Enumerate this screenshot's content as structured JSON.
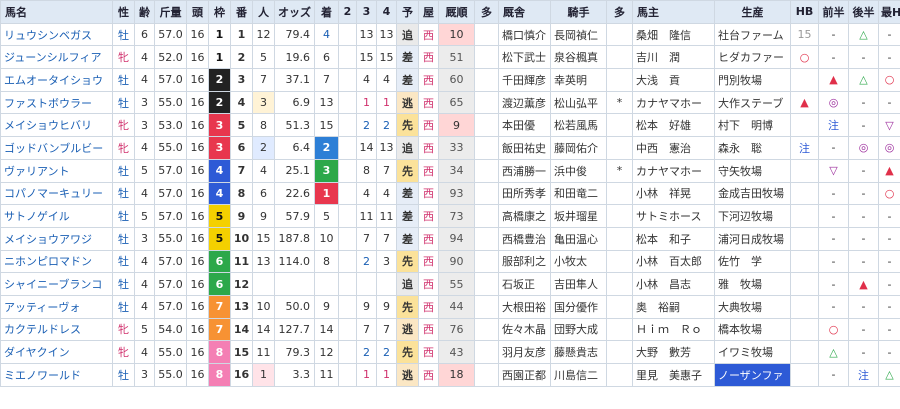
{
  "headers": [
    "馬名",
    "性",
    "齢",
    "斤量",
    "頭",
    "枠",
    "番",
    "人",
    "オッズ",
    "着",
    "2",
    "3",
    "4",
    "予",
    "屋",
    "厩順",
    "多",
    "厩舎",
    "騎手",
    "多",
    "馬主",
    "生産",
    "HB",
    "前半",
    "後半",
    "最H"
  ],
  "rows": [
    {
      "name": "リュウシンベガス",
      "sex": "牡",
      "age": "6",
      "kin": "57.0",
      "tou": "16",
      "waku": "1",
      "ban": "1",
      "pop": "12",
      "odds": "79.4",
      "chaku": "4",
      "c2": "",
      "c3": "13",
      "c4": "13",
      "yoso": "追",
      "ya": "西",
      "kyuu": "10",
      "ta": "",
      "stable": "橋口慎介",
      "jockey": "長岡禎仁",
      "ta2": "",
      "owner": "桑畑　隆信",
      "breeder": "社台ファーム",
      "hb": "15",
      "zen": "-",
      "kou": "△",
      "saih": "-"
    },
    {
      "name": "ジューンシルフィア",
      "sex": "牝",
      "age": "4",
      "kin": "52.0",
      "tou": "16",
      "waku": "1",
      "ban": "2",
      "pop": "5",
      "odds": "19.6",
      "chaku": "6",
      "c2": "",
      "c3": "15",
      "c4": "15",
      "yoso": "差",
      "ya": "西",
      "kyuu": "51",
      "ta": "",
      "stable": "松下武士",
      "jockey": "泉谷楓真",
      "ta2": "",
      "owner": "吉川　潤",
      "breeder": "ヒダカファー",
      "hb": "○",
      "zen": "-",
      "kou": "-",
      "saih": "-"
    },
    {
      "name": "エムオータイショウ",
      "sex": "牡",
      "age": "4",
      "kin": "57.0",
      "tou": "16",
      "waku": "2",
      "ban": "3",
      "pop": "7",
      "odds": "37.1",
      "chaku": "7",
      "c2": "",
      "c3": "4",
      "c4": "4",
      "yoso": "差",
      "ya": "西",
      "kyuu": "60",
      "ta": "",
      "stable": "千田輝彦",
      "jockey": "幸英明",
      "ta2": "",
      "owner": "大浅　貢",
      "breeder": "門別牧場",
      "hb": "",
      "zen": "▲",
      "kou": "△",
      "saih": "○"
    },
    {
      "name": "ファストボウラー",
      "sex": "牡",
      "age": "3",
      "kin": "55.0",
      "tou": "16",
      "waku": "2",
      "ban": "4",
      "pop": "3",
      "odds": "6.9",
      "chaku": "13",
      "c2": "",
      "c3": "1",
      "c4": "1",
      "yoso": "逃",
      "ya": "西",
      "kyuu": "65",
      "ta": "",
      "stable": "渡辺薫彦",
      "jockey": "松山弘平",
      "ta2": "*",
      "owner": "カナヤマホー",
      "breeder": "大作ステーブ",
      "hb": "▲",
      "zen": "◎",
      "kou": "-",
      "saih": "-"
    },
    {
      "name": "メイショウヒバリ",
      "sex": "牝",
      "age": "3",
      "kin": "53.0",
      "tou": "16",
      "waku": "3",
      "ban": "5",
      "pop": "8",
      "odds": "51.3",
      "chaku": "15",
      "c2": "",
      "c3": "2",
      "c4": "2",
      "yoso": "先",
      "ya": "西",
      "kyuu": "9",
      "ta": "",
      "stable": "本田優",
      "jockey": "松若風馬",
      "ta2": "",
      "owner": "松本　好雄",
      "breeder": "村下　明博",
      "hb": "",
      "zen": "注",
      "kou": "-",
      "saih": "▽"
    },
    {
      "name": "ゴッドバンブルビー",
      "sex": "牝",
      "age": "4",
      "kin": "55.0",
      "tou": "16",
      "waku": "3",
      "ban": "6",
      "pop": "2",
      "odds": "6.4",
      "chaku": "2",
      "c2": "",
      "c3": "14",
      "c4": "13",
      "yoso": "追",
      "ya": "西",
      "kyuu": "33",
      "ta": "",
      "stable": "飯田祐史",
      "jockey": "藤岡佑介",
      "ta2": "",
      "owner": "中西　憲治",
      "breeder": "森永　聡",
      "hb": "注",
      "zen": "-",
      "kou": "◎",
      "saih": "◎"
    },
    {
      "name": "ヴァリアント",
      "sex": "牡",
      "age": "5",
      "kin": "57.0",
      "tou": "16",
      "waku": "4",
      "ban": "7",
      "pop": "4",
      "odds": "25.1",
      "chaku": "3",
      "c2": "",
      "c3": "8",
      "c4": "7",
      "yoso": "先",
      "ya": "西",
      "kyuu": "34",
      "ta": "",
      "stable": "西浦勝一",
      "jockey": "浜中俊",
      "ta2": "*",
      "owner": "カナヤマホー",
      "breeder": "守矢牧場",
      "hb": "",
      "zen": "▽",
      "kou": "-",
      "saih": "▲"
    },
    {
      "name": "コパノマーキュリー",
      "sex": "牡",
      "age": "4",
      "kin": "57.0",
      "tou": "16",
      "waku": "4",
      "ban": "8",
      "pop": "6",
      "odds": "22.6",
      "chaku": "1",
      "c2": "",
      "c3": "4",
      "c4": "4",
      "yoso": "差",
      "ya": "西",
      "kyuu": "93",
      "ta": "",
      "stable": "田所秀孝",
      "jockey": "和田竜二",
      "ta2": "",
      "owner": "小林　祥晃",
      "breeder": "金成吉田牧場",
      "hb": "",
      "zen": "-",
      "kou": "-",
      "saih": "○"
    },
    {
      "name": "サトノゲイル",
      "sex": "牡",
      "age": "5",
      "kin": "57.0",
      "tou": "16",
      "waku": "5",
      "ban": "9",
      "pop": "9",
      "odds": "57.9",
      "chaku": "5",
      "c2": "",
      "c3": "11",
      "c4": "11",
      "yoso": "差",
      "ya": "西",
      "kyuu": "73",
      "ta": "",
      "stable": "高橋康之",
      "jockey": "坂井瑠星",
      "ta2": "",
      "owner": "サトミホース",
      "breeder": "下河辺牧場",
      "hb": "",
      "zen": "-",
      "kou": "-",
      "saih": "-"
    },
    {
      "name": "メイショウアワジ",
      "sex": "牡",
      "age": "3",
      "kin": "55.0",
      "tou": "16",
      "waku": "5",
      "ban": "10",
      "pop": "15",
      "odds": "187.8",
      "chaku": "10",
      "c2": "",
      "c3": "7",
      "c4": "7",
      "yoso": "差",
      "ya": "西",
      "kyuu": "94",
      "ta": "",
      "stable": "西橋豊治",
      "jockey": "亀田温心",
      "ta2": "",
      "owner": "松本　和子",
      "breeder": "浦河日成牧場",
      "hb": "",
      "zen": "-",
      "kou": "-",
      "saih": "-"
    },
    {
      "name": "ニホンピロマドン",
      "sex": "牡",
      "age": "4",
      "kin": "57.0",
      "tou": "16",
      "waku": "6",
      "ban": "11",
      "pop": "13",
      "odds": "114.0",
      "chaku": "8",
      "c2": "",
      "c3": "2",
      "c4": "3",
      "yoso": "先",
      "ya": "西",
      "kyuu": "90",
      "ta": "",
      "stable": "服部利之",
      "jockey": "小牧太",
      "ta2": "",
      "owner": "小林　百太郎",
      "breeder": "佐竹　学",
      "hb": "",
      "zen": "-",
      "kou": "-",
      "saih": "-"
    },
    {
      "name": "シャイニーブランコ",
      "sex": "牡",
      "age": "4",
      "kin": "57.0",
      "tou": "16",
      "waku": "6",
      "ban": "12",
      "pop": "",
      "odds": "",
      "chaku": "",
      "c2": "",
      "c3": "",
      "c4": "",
      "yoso": "追",
      "ya": "西",
      "kyuu": "55",
      "ta": "",
      "stable": "石坂正",
      "jockey": "吉田隼人",
      "ta2": "",
      "owner": "小林　昌志",
      "breeder": "雅　牧場",
      "hb": "",
      "zen": "-",
      "kou": "▲",
      "saih": "-"
    },
    {
      "name": "アッティーヴォ",
      "sex": "牡",
      "age": "4",
      "kin": "57.0",
      "tou": "16",
      "waku": "7",
      "ban": "13",
      "pop": "10",
      "odds": "50.0",
      "chaku": "9",
      "c2": "",
      "c3": "9",
      "c4": "9",
      "yoso": "先",
      "ya": "西",
      "kyuu": "44",
      "ta": "",
      "stable": "大根田裕",
      "jockey": "国分優作",
      "ta2": "",
      "owner": "奥　裕嗣",
      "breeder": "大典牧場",
      "hb": "",
      "zen": "-",
      "kou": "-",
      "saih": "-"
    },
    {
      "name": "カクテルドレス",
      "sex": "牝",
      "age": "5",
      "kin": "54.0",
      "tou": "16",
      "waku": "7",
      "ban": "14",
      "pop": "14",
      "odds": "127.7",
      "chaku": "14",
      "c2": "",
      "c3": "7",
      "c4": "7",
      "yoso": "逃",
      "ya": "西",
      "kyuu": "76",
      "ta": "",
      "stable": "佐々木晶",
      "jockey": "団野大成",
      "ta2": "",
      "owner": "Ｈｉｍ　Ｒｏ",
      "breeder": "橋本牧場",
      "hb": "",
      "zen": "○",
      "kou": "-",
      "saih": "-"
    },
    {
      "name": "ダイヤクイン",
      "sex": "牝",
      "age": "4",
      "kin": "55.0",
      "tou": "16",
      "waku": "8",
      "ban": "15",
      "pop": "11",
      "odds": "79.3",
      "chaku": "12",
      "c2": "",
      "c3": "2",
      "c4": "2",
      "yoso": "先",
      "ya": "西",
      "kyuu": "43",
      "ta": "",
      "stable": "羽月友彦",
      "jockey": "藤懸貴志",
      "ta2": "",
      "owner": "大野　數芳",
      "breeder": "イワミ牧場",
      "hb": "",
      "zen": "△",
      "kou": "-",
      "saih": "-"
    },
    {
      "name": "ミエノワールド",
      "sex": "牡",
      "age": "3",
      "kin": "55.0",
      "tou": "16",
      "waku": "8",
      "ban": "16",
      "pop": "1",
      "odds": "3.3",
      "chaku": "11",
      "c2": "",
      "c3": "1",
      "c4": "1",
      "yoso": "逃",
      "ya": "西",
      "kyuu": "18",
      "ta": "",
      "stable": "西園正都",
      "jockey": "川島信二",
      "ta2": "",
      "owner": "里見　美惠子",
      "breeder": "ノーザンファ",
      "hb": "",
      "zen": "-",
      "kou": "注",
      "saih": "△"
    }
  ]
}
